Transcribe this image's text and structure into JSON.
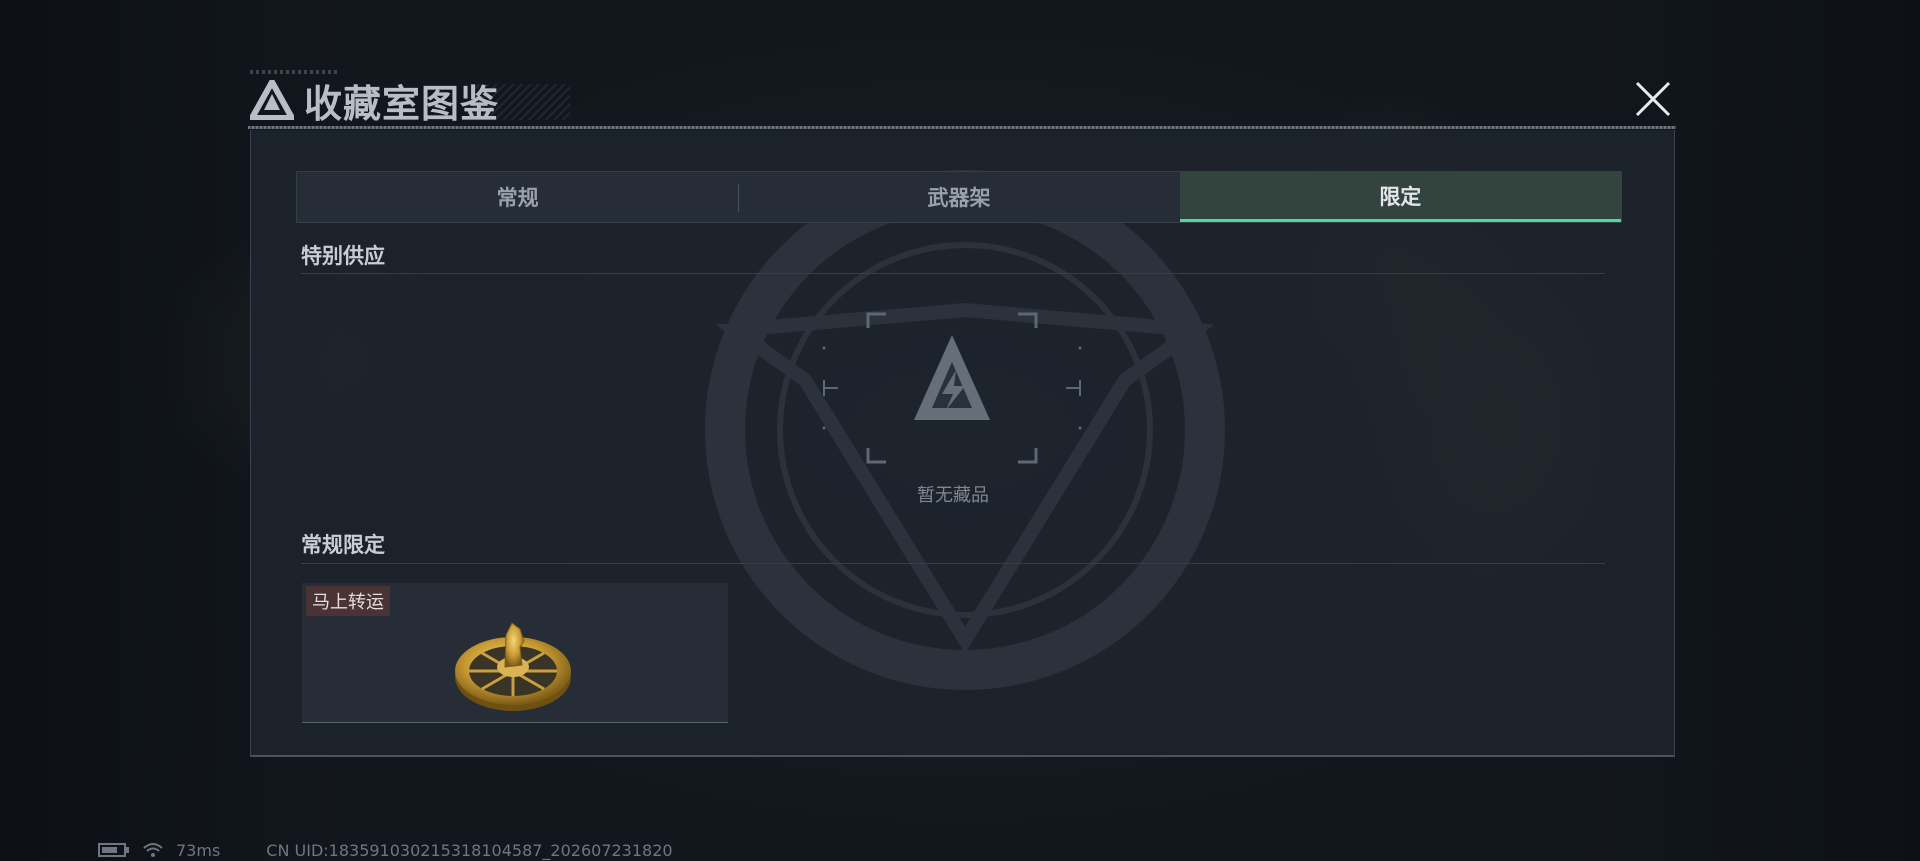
{
  "dialog": {
    "title": "收藏室图鉴",
    "title_icon": "delta-logo-icon",
    "close_icon": "close-icon"
  },
  "tabs": [
    {
      "label": "常规",
      "active": false
    },
    {
      "label": "武器架",
      "active": false
    },
    {
      "label": "限定",
      "active": true
    }
  ],
  "sections": {
    "special": {
      "title": "特别供应",
      "empty_text": "暂无藏品",
      "empty_icon": "delta-logo-icon"
    },
    "limited": {
      "title": "常规限定",
      "items": [
        {
          "tag": "马上转运",
          "image": "golden-horse-coin-icon"
        }
      ]
    }
  },
  "status_bar": {
    "battery_icon": "battery-icon",
    "wifi_icon": "wifi-icon",
    "latency": "73ms",
    "uid": "CN UID:1835910302153181045​87_202607231820"
  },
  "colors": {
    "accent": "#4fd8a2",
    "active_tab_bg": "#33443f",
    "tag_bg": "#4a3334"
  }
}
